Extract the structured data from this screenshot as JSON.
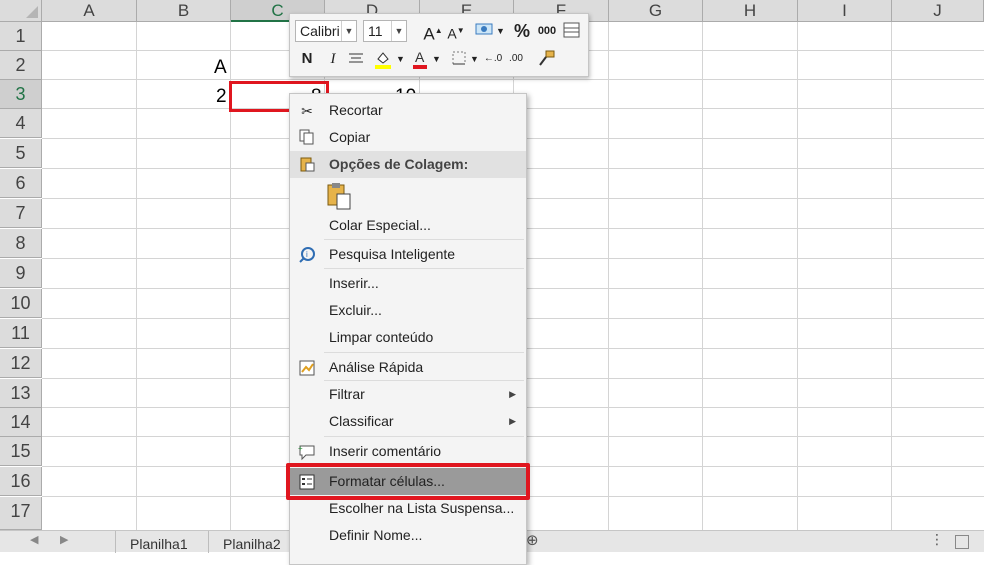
{
  "columns": [
    "A",
    "B",
    "C",
    "D",
    "E",
    "F",
    "G",
    "H",
    "I",
    "J"
  ],
  "selected_column": "C",
  "rows": [
    "1",
    "2",
    "3",
    "4",
    "5",
    "6",
    "7",
    "8",
    "9",
    "10",
    "11",
    "12",
    "13",
    "14",
    "15",
    "16",
    "17"
  ],
  "selected_row": "3",
  "cells": {
    "B2": "A",
    "B3": "2",
    "C3": "8",
    "D3": "10"
  },
  "sheet_tabs": [
    "Planilha1",
    "Planilha2"
  ],
  "mini_toolbar": {
    "font_name": "Calibri",
    "font_size": "11",
    "increase_font": "A",
    "decrease_font": "A",
    "percent": "%",
    "thousands": "000",
    "bold": "N",
    "italic": "I",
    "highlight_color": "#ffff00",
    "font_color": "#e0161f"
  },
  "context_menu": {
    "cut": "Recortar",
    "copy": "Copiar",
    "paste_options": "Opções de Colagem:",
    "paste_special": "Colar Especial...",
    "smart_lookup": "Pesquisa Inteligente",
    "insert": "Inserir...",
    "delete": "Excluir...",
    "clear_contents": "Limpar conteúdo",
    "quick_analysis": "Análise Rápida",
    "filter": "Filtrar",
    "sort": "Classificar",
    "insert_comment": "Inserir comentário",
    "format_cells": "Formatar células...",
    "pick_from_list": "Escolher na Lista Suspensa...",
    "define_name": "Definir Nome..."
  },
  "colors": {
    "highlight_red": "#e0161f",
    "excel_green": "#217346"
  }
}
